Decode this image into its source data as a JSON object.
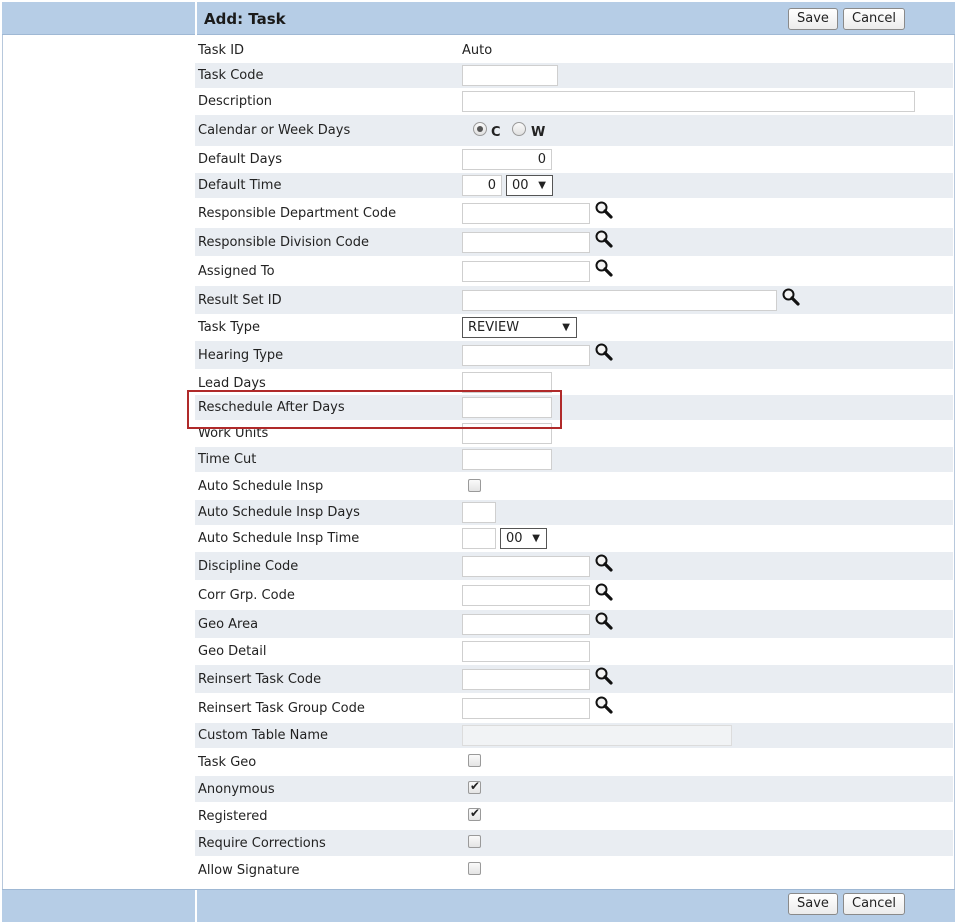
{
  "header": {
    "title": "Add: Task",
    "save_label": "Save",
    "cancel_label": "Cancel"
  },
  "footer": {
    "save_label": "Save",
    "cancel_label": "Cancel"
  },
  "fields": {
    "task_id": {
      "label": "Task ID",
      "value": "Auto"
    },
    "task_code": {
      "label": "Task Code",
      "value": ""
    },
    "description": {
      "label": "Description",
      "value": ""
    },
    "calendar_or_week_days": {
      "label": "Calendar or Week Days",
      "option_c": "C",
      "option_w": "W",
      "selected": "C"
    },
    "default_days": {
      "label": "Default Days",
      "value": "0"
    },
    "default_time": {
      "label": "Default Time",
      "hour": "0",
      "minute": "00"
    },
    "responsible_department_code": {
      "label": "Responsible Department Code",
      "value": ""
    },
    "responsible_division_code": {
      "label": "Responsible Division Code",
      "value": ""
    },
    "assigned_to": {
      "label": "Assigned To",
      "value": ""
    },
    "result_set_id": {
      "label": "Result Set ID",
      "value": ""
    },
    "task_type": {
      "label": "Task Type",
      "value": "REVIEW"
    },
    "hearing_type": {
      "label": "Hearing Type",
      "value": ""
    },
    "lead_days": {
      "label": "Lead Days",
      "value": ""
    },
    "reschedule_after_days": {
      "label": "Reschedule After Days",
      "value": ""
    },
    "work_units": {
      "label": "Work Units",
      "value": ""
    },
    "time_cut": {
      "label": "Time Cut",
      "value": ""
    },
    "auto_schedule_insp": {
      "label": "Auto Schedule Insp",
      "checked": false
    },
    "auto_schedule_insp_days": {
      "label": "Auto Schedule Insp Days",
      "value": ""
    },
    "auto_schedule_insp_time": {
      "label": "Auto Schedule Insp Time",
      "hour": "",
      "minute": "00"
    },
    "discipline_code": {
      "label": "Discipline Code",
      "value": ""
    },
    "corr_grp_code": {
      "label": "Corr Grp. Code",
      "value": ""
    },
    "geo_area": {
      "label": "Geo Area",
      "value": ""
    },
    "geo_detail": {
      "label": "Geo Detail",
      "value": ""
    },
    "reinsert_task_code": {
      "label": "Reinsert Task Code",
      "value": ""
    },
    "reinsert_task_group_code": {
      "label": "Reinsert Task Group Code",
      "value": ""
    },
    "custom_table_name": {
      "label": "Custom Table Name",
      "value": ""
    },
    "task_geo": {
      "label": "Task Geo",
      "checked": false
    },
    "anonymous": {
      "label": "Anonymous",
      "checked": true
    },
    "registered": {
      "label": "Registered",
      "checked": true
    },
    "require_corrections": {
      "label": "Require Corrections",
      "checked": false
    },
    "allow_signature": {
      "label": "Allow Signature",
      "checked": false
    }
  },
  "colors": {
    "header_bg": "#b6cde6",
    "row_alt": "#e9edf2",
    "highlight": "#b02a2a"
  },
  "icons": {
    "lookup": "magnifier-icon",
    "check": "checkmark-icon"
  }
}
